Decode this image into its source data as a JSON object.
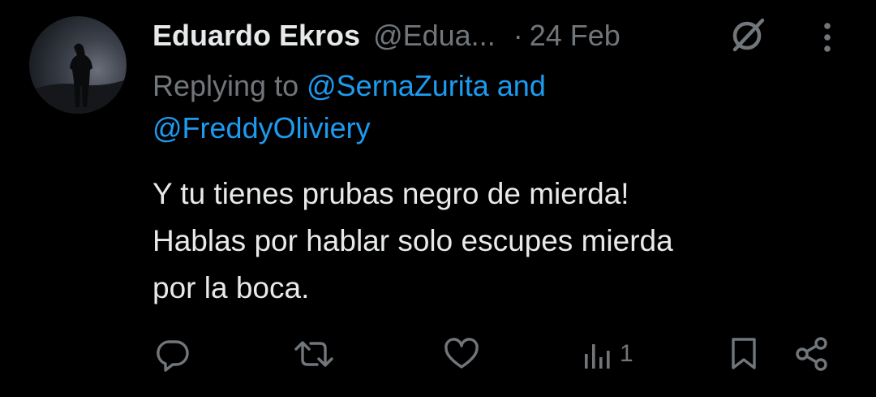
{
  "tweet": {
    "author": {
      "display_name": "Eduardo Ekros",
      "handle": "@Edua...",
      "avatar_icon": "profile-photo-silhouette"
    },
    "separator": "·",
    "date": "24 Feb",
    "reply_prefix": "Replying to",
    "mentions": [
      "@SernaZurita",
      "@FreddyOliviery"
    ],
    "mention_joiner": "and",
    "text": "Y tu tienes prubas negro de mierda!\nHablas por hablar solo escupes mierda\npor la boca.",
    "actions": {
      "reply": {
        "icon": "reply-icon"
      },
      "retweet": {
        "icon": "retweet-icon"
      },
      "like": {
        "icon": "like-icon"
      },
      "views": {
        "icon": "views-icon",
        "count": "1"
      },
      "bookmark": {
        "icon": "bookmark-icon"
      },
      "share": {
        "icon": "share-icon"
      }
    },
    "header_icons": [
      "grok-icon",
      "more-options-icon"
    ]
  },
  "colors": {
    "background": "#000000",
    "primary_text": "#e7e9ea",
    "secondary_text": "#71767b",
    "accent": "#1d9bf0"
  }
}
